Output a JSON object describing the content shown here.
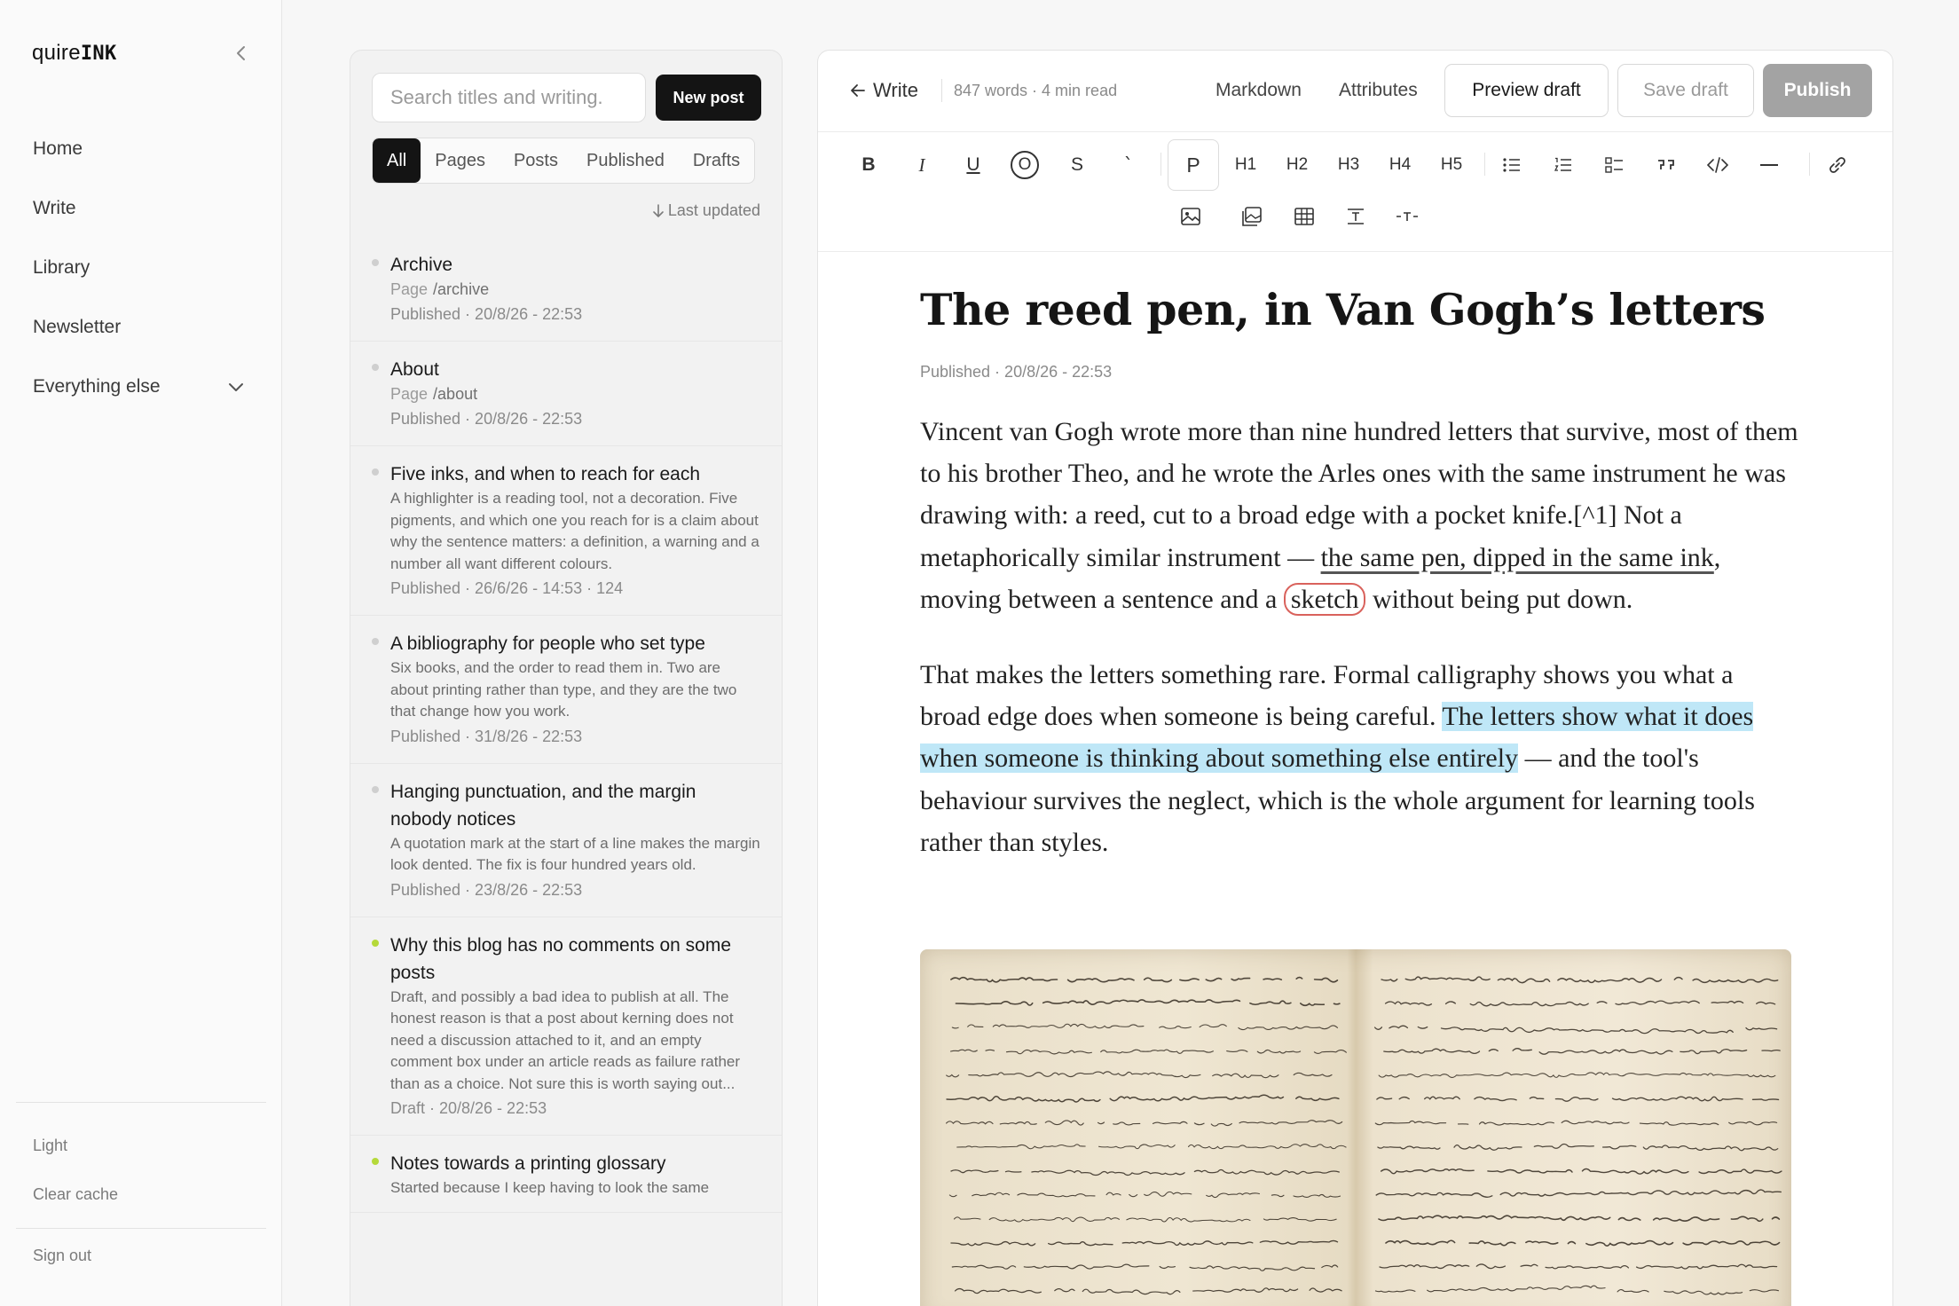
{
  "app": {
    "brand_regular": "quire",
    "brand_mono": "INK"
  },
  "sidebar": {
    "nav": [
      {
        "label": "Home"
      },
      {
        "label": "Write"
      },
      {
        "label": "Library"
      },
      {
        "label": "Newsletter"
      },
      {
        "label": "Everything else"
      }
    ],
    "light_label": "Light",
    "clear_cache_label": "Clear cache",
    "sign_out_label": "Sign out"
  },
  "list": {
    "search_placeholder": "Search titles and writing.",
    "new_post_label": "New post",
    "filters": [
      "All",
      "Pages",
      "Posts",
      "Published",
      "Drafts"
    ],
    "active_filter": "All",
    "sort_label": "Last updated",
    "posts": [
      {
        "title": "Archive",
        "kind": "Page",
        "path": "/archive",
        "status": "Published · 20/8/26 - 22:53",
        "draft": false
      },
      {
        "title": "About",
        "kind": "Page",
        "path": "/about",
        "status": "Published · 20/8/26 - 22:53",
        "draft": false
      },
      {
        "title": "Five inks, and when to reach for each",
        "desc": "A highlighter is a reading tool, not a decoration. Five pigments, and which one you reach for is a claim about why the sentence matters: a definition, a warning and a number all want different colours.",
        "status": "Published · 26/6/26 - 14:53 · 124",
        "draft": false
      },
      {
        "title": "A bibliography for people who set type",
        "desc": "Six books, and the order to read them in. Two are about printing rather than type, and they are the two that change how you work.",
        "status": "Published · 31/8/26 - 22:53",
        "draft": false
      },
      {
        "title": "Hanging punctuation, and the margin nobody notices",
        "desc": "A quotation mark at the start of a line makes the margin look dented. The fix is four hundred years old.",
        "status": "Published · 23/8/26 - 22:53",
        "draft": false
      },
      {
        "title": "Why this blog has no comments on some posts",
        "desc": "Draft, and possibly a bad idea to publish at all. The honest reason is that a post about kerning does not need a discussion attached to it, and an empty comment box under an article reads as failure rather than as a choice. Not sure this is worth saying out...",
        "status": "Draft · 20/8/26 - 22:53",
        "draft": true
      },
      {
        "title": "Notes towards a printing glossary",
        "desc": "Started because I keep having to look the same",
        "status": "",
        "draft": true
      }
    ]
  },
  "editor": {
    "back_label": "Write",
    "stats": "847 words · 4 min read",
    "markdown_label": "Markdown",
    "attributes_label": "Attributes",
    "preview_label": "Preview draft",
    "save_label": "Save draft",
    "publish_label": "Publish",
    "toolbar": {
      "bold": "B",
      "italic": "I",
      "underline": "U",
      "circle": "O",
      "strike": "S",
      "code": "`",
      "p": "P",
      "h1": "H1",
      "h2": "H2",
      "h3": "H3",
      "h4": "H4",
      "h5": "H5"
    },
    "doc": {
      "title": "The reed pen, in Van Gogh’s letters",
      "meta": "Published · 20/8/26 - 22:53",
      "p1_a": "Vincent van Gogh wrote more than nine hundred letters that survive, most of them to his brother Theo, and he wrote the Arles ones with the same instrument he was drawing with: a reed, cut to a broad edge with a pocket knife.[^1] Not a metaphorically similar instrument — ",
      "p1_underline": "the same pen, dipped in the same ink",
      "p1_b": ", moving between a sentence and a ",
      "p1_circled": "sketch",
      "p1_c": " without being put down.",
      "p2_a": "That makes the letters something rare. Formal calligraphy shows you what a broad edge does when someone is being careful. ",
      "p2_highlight": "The letters show what it does when someone is thinking about something else entirely",
      "p2_b": " — and the tool's behaviour survives the neglect, which is the whole argument for learning tools rather than styles."
    }
  }
}
